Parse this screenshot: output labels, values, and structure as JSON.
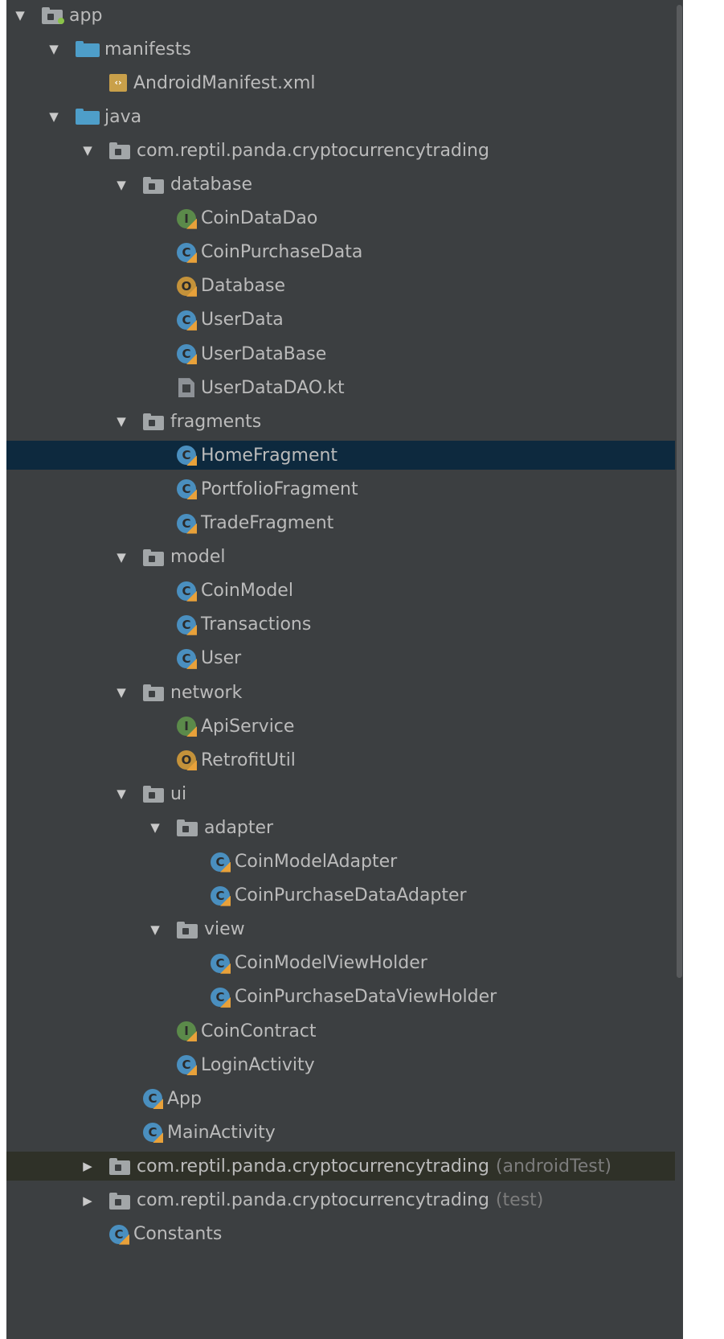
{
  "tree": [
    {
      "depth": 0,
      "arrow": "down",
      "icon": "app-module-icon",
      "label": "app"
    },
    {
      "depth": 1,
      "arrow": "down",
      "icon": "folder-icon",
      "label": "manifests"
    },
    {
      "depth": 2,
      "arrow": "none",
      "icon": "xml-file-icon",
      "label": "AndroidManifest.xml"
    },
    {
      "depth": 1,
      "arrow": "down",
      "icon": "folder-icon",
      "label": "java"
    },
    {
      "depth": 2,
      "arrow": "down",
      "icon": "package-icon",
      "label": "com.reptil.panda.cryptocurrencytrading"
    },
    {
      "depth": 3,
      "arrow": "down",
      "icon": "package-icon",
      "label": "database"
    },
    {
      "depth": 4,
      "arrow": "none",
      "icon": "interface-icon",
      "label": "CoinDataDao"
    },
    {
      "depth": 4,
      "arrow": "none",
      "icon": "class-icon",
      "label": "CoinPurchaseData"
    },
    {
      "depth": 4,
      "arrow": "none",
      "icon": "object-icon",
      "label": "Database"
    },
    {
      "depth": 4,
      "arrow": "none",
      "icon": "class-icon",
      "label": "UserData"
    },
    {
      "depth": 4,
      "arrow": "none",
      "icon": "abstract-class-icon",
      "label": "UserDataBase"
    },
    {
      "depth": 4,
      "arrow": "none",
      "icon": "kotlin-file-icon",
      "label": "UserDataDAO.kt"
    },
    {
      "depth": 3,
      "arrow": "down",
      "icon": "package-icon",
      "label": "fragments"
    },
    {
      "depth": 4,
      "arrow": "none",
      "icon": "class-icon",
      "label": "HomeFragment",
      "selected": true
    },
    {
      "depth": 4,
      "arrow": "none",
      "icon": "class-icon",
      "label": "PortfolioFragment"
    },
    {
      "depth": 4,
      "arrow": "none",
      "icon": "class-icon",
      "label": "TradeFragment"
    },
    {
      "depth": 3,
      "arrow": "down",
      "icon": "package-icon",
      "label": "model"
    },
    {
      "depth": 4,
      "arrow": "none",
      "icon": "class-icon",
      "label": "CoinModel"
    },
    {
      "depth": 4,
      "arrow": "none",
      "icon": "class-icon",
      "label": "Transactions"
    },
    {
      "depth": 4,
      "arrow": "none",
      "icon": "class-icon",
      "label": "User"
    },
    {
      "depth": 3,
      "arrow": "down",
      "icon": "package-icon",
      "label": "network"
    },
    {
      "depth": 4,
      "arrow": "none",
      "icon": "interface-icon",
      "label": "ApiService"
    },
    {
      "depth": 4,
      "arrow": "none",
      "icon": "object-icon",
      "label": "RetrofitUtil"
    },
    {
      "depth": 3,
      "arrow": "down",
      "icon": "package-icon",
      "label": "ui"
    },
    {
      "depth": 4,
      "arrow": "down",
      "icon": "package-icon",
      "label": "adapter"
    },
    {
      "depth": 5,
      "arrow": "none",
      "icon": "class-icon",
      "label": "CoinModelAdapter"
    },
    {
      "depth": 5,
      "arrow": "none",
      "icon": "class-icon",
      "label": "CoinPurchaseDataAdapter"
    },
    {
      "depth": 4,
      "arrow": "down",
      "icon": "package-icon",
      "label": "view"
    },
    {
      "depth": 5,
      "arrow": "none",
      "icon": "class-icon",
      "label": "CoinModelViewHolder"
    },
    {
      "depth": 5,
      "arrow": "none",
      "icon": "class-icon",
      "label": "CoinPurchaseDataViewHolder"
    },
    {
      "depth": 4,
      "arrow": "none",
      "icon": "interface-icon",
      "label": "CoinContract"
    },
    {
      "depth": 4,
      "arrow": "none",
      "icon": "class-icon",
      "label": "LoginActivity"
    },
    {
      "depth": 3,
      "arrow": "none",
      "icon": "class-icon",
      "label": "App"
    },
    {
      "depth": 3,
      "arrow": "none",
      "icon": "class-icon",
      "label": "MainActivity"
    },
    {
      "depth": 2,
      "arrow": "right",
      "icon": "package-icon",
      "label": "com.reptil.panda.cryptocurrencytrading",
      "suffix": "(androidTest)",
      "tinted": true
    },
    {
      "depth": 2,
      "arrow": "right",
      "icon": "package-icon",
      "label": "com.reptil.panda.cryptocurrencytrading",
      "suffix": "(test)"
    },
    {
      "depth": 2,
      "arrow": "none",
      "icon": "class-icon",
      "label": "Constants"
    }
  ],
  "colors": {
    "panel_bg": "#3c3f41",
    "selection": "#0d293e",
    "text": "#bbbbbb",
    "suffix_text": "#7c7c7c",
    "class_icon": "#4a8fbf",
    "interface_icon": "#5b8a4a",
    "object_icon": "#c4923a",
    "folder_blue": "#4e9ec9"
  }
}
